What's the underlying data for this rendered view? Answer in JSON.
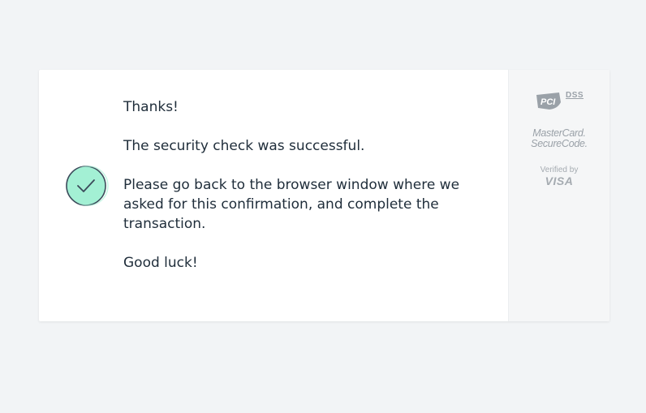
{
  "message": {
    "line1": "Thanks!",
    "line2": "The security check was successful.",
    "line3": "Please go back to the browser window where we asked for this confirmation, and complete the transaction.",
    "line4": "Good luck!"
  },
  "status_icon": "checkmark-circle-icon",
  "badges": {
    "pci_logo_text": "PCI",
    "pci_dss": "DSS",
    "mastercard_line1": "MasterCard.",
    "mastercard_line2": "SecureCode.",
    "visa_line1": "Verified by",
    "visa_line2": "VISA"
  },
  "colors": {
    "background": "#f2f4f6",
    "card": "#ffffff",
    "sidebar": "#f5f6f7",
    "check_fill": "#a3f0d4",
    "check_stroke": "#3b4a5a",
    "text": "#1f2d3a",
    "badge_gray": "#9aa1a8"
  }
}
